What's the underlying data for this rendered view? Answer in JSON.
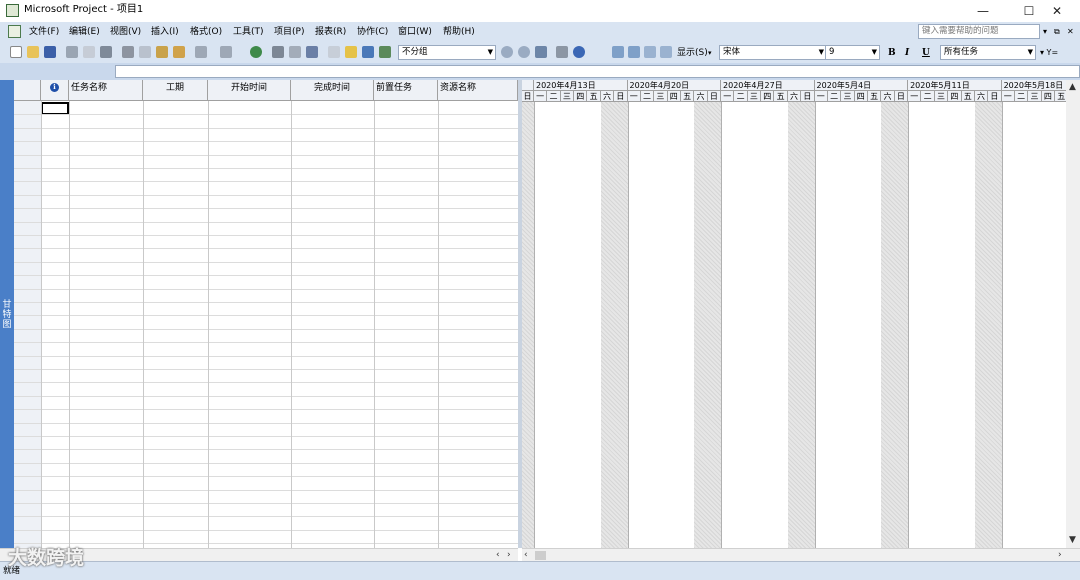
{
  "window": {
    "title": "Microsoft Project - 项目1",
    "minimize_glyph": "—",
    "maximize_glyph": "☐",
    "close_glyph": "✕"
  },
  "menubar": {
    "items": [
      "文件(F)",
      "编辑(E)",
      "视图(V)",
      "插入(I)",
      "格式(O)",
      "工具(T)",
      "项目(P)",
      "报表(R)",
      "协作(C)",
      "窗口(W)",
      "帮助(H)"
    ],
    "help_placeholder": "键入需要帮助的问题",
    "doc_controls": [
      "▾",
      "⧉",
      "✕"
    ]
  },
  "toolbar": {
    "group_by": "不分组",
    "show_label": "显示(S)",
    "font": "宋体",
    "font_size": "9",
    "bold": "B",
    "italic": "I",
    "underline": "U",
    "filter": "所有任务",
    "autofilter": "▾ Y="
  },
  "view": {
    "label": "甘特图"
  },
  "table": {
    "columns": [
      "",
      "ℹ",
      "任务名称",
      "工期",
      "开始时间",
      "完成时间",
      "前置任务",
      "资源名称"
    ]
  },
  "gantt": {
    "weeks": [
      "2020年4月13日",
      "2020年4月20日",
      "2020年4月27日",
      "2020年5月4日",
      "2020年5月11日",
      "2020年5月18日"
    ],
    "days": [
      "日",
      "一",
      "二",
      "三",
      "四",
      "五",
      "六"
    ]
  },
  "status": {
    "text": "就绪"
  },
  "watermark": {
    "text": "大数跨境"
  },
  "colors": {
    "chrome": "#d9e4f2",
    "viewbar": "#4a7fc8",
    "header": "#eef1f6"
  }
}
